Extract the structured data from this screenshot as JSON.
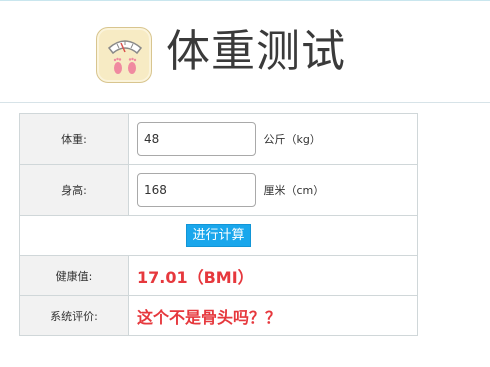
{
  "header": {
    "title": "体重测试",
    "icon": "bathroom-scale-icon"
  },
  "form": {
    "weight": {
      "label": "体重:",
      "value": "48",
      "unit": "公斤（kg）"
    },
    "height": {
      "label": "身高:",
      "value": "168",
      "unit": "厘米（cm）"
    },
    "calculate_label": "进行计算",
    "health": {
      "label": "健康值:",
      "value": "17.01（BMI）"
    },
    "evaluation": {
      "label": "系统评价:",
      "value": "这个不是骨头吗？？"
    }
  },
  "colors": {
    "button": "#1aa7ec",
    "result": "#e6383d",
    "label_bg": "#f2f2f2"
  }
}
